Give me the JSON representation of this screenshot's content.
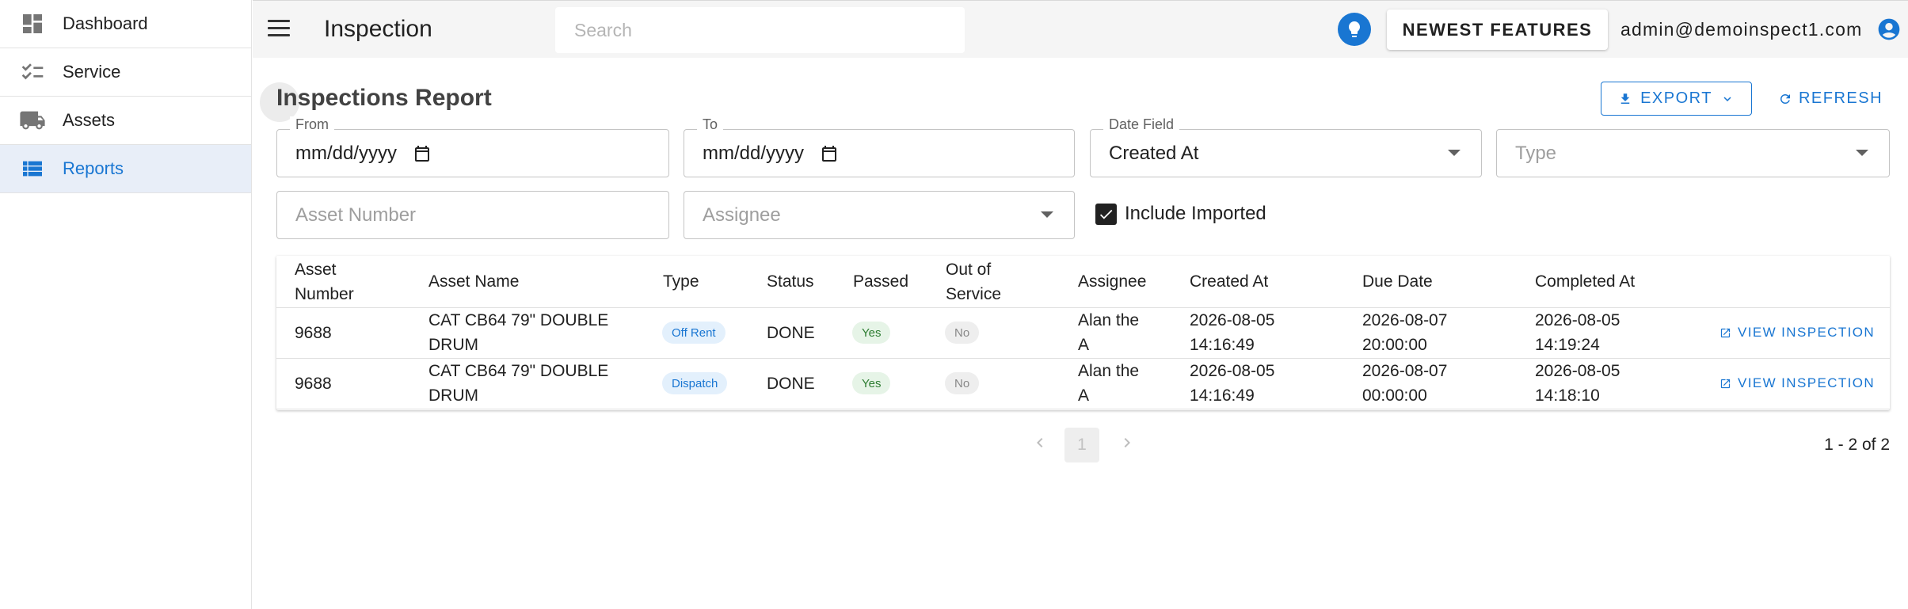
{
  "sidebar": {
    "items": [
      {
        "label": "Dashboard",
        "icon": "dashboard-icon"
      },
      {
        "label": "Service",
        "icon": "checklist-icon"
      },
      {
        "label": "Assets",
        "icon": "truck-icon"
      },
      {
        "label": "Reports",
        "icon": "list-icon",
        "active": true
      }
    ]
  },
  "header": {
    "title": "Inspection",
    "search_placeholder": "Search",
    "newest_features_label": "NEWEST FEATURES",
    "user_email": "admin@demoinspect1.com"
  },
  "page": {
    "title": "Inspections Report",
    "export_label": "EXPORT",
    "refresh_label": "REFRESH"
  },
  "filters": {
    "from": {
      "label": "From",
      "value": "mm/dd/yyyy"
    },
    "to": {
      "label": "To",
      "value": "mm/dd/yyyy"
    },
    "date_field": {
      "label": "Date Field",
      "value": "Created At"
    },
    "type": {
      "placeholder": "Type"
    },
    "asset_number": {
      "placeholder": "Asset Number"
    },
    "assignee": {
      "placeholder": "Assignee"
    },
    "include_imported": {
      "label": "Include Imported",
      "checked": true
    }
  },
  "table": {
    "headers": {
      "asset_number_1": "Asset",
      "asset_number_2": "Number",
      "asset_name": "Asset Name",
      "type": "Type",
      "status": "Status",
      "passed": "Passed",
      "out_of_service_1": "Out of",
      "out_of_service_2": "Service",
      "assignee": "Assignee",
      "created_at": "Created At",
      "due_date": "Due Date",
      "completed_at": "Completed At"
    },
    "rows": [
      {
        "asset_number": "9688",
        "asset_name_1": "CAT CB64 79\" DOUBLE",
        "asset_name_2": "DRUM",
        "type": "Off Rent",
        "status": "DONE",
        "passed": "Yes",
        "out_of_service": "No",
        "assignee_1": "Alan the",
        "assignee_2": "A",
        "created_date": "2026-08-05",
        "created_time": "14:16:49",
        "due_date": "2026-08-07",
        "due_time": "20:00:00",
        "completed_date": "2026-08-05",
        "completed_time": "14:19:24",
        "action": "VIEW INSPECTION"
      },
      {
        "asset_number": "9688",
        "asset_name_1": "CAT CB64 79\" DOUBLE",
        "asset_name_2": "DRUM",
        "type": "Dispatch",
        "status": "DONE",
        "passed": "Yes",
        "out_of_service": "No",
        "assignee_1": "Alan the",
        "assignee_2": "A",
        "created_date": "2026-08-05",
        "created_time": "14:16:49",
        "due_date": "2026-08-07",
        "due_time": "00:00:00",
        "completed_date": "2026-08-05",
        "completed_time": "14:18:10",
        "action": "VIEW INSPECTION"
      }
    ]
  },
  "pagination": {
    "current_page": "1",
    "range_text": "1 - 2 of 2"
  },
  "colors": {
    "primary": "#1976d2",
    "active_nav_bg": "#e8eef8",
    "topbar_bg": "#f5f5f5"
  }
}
